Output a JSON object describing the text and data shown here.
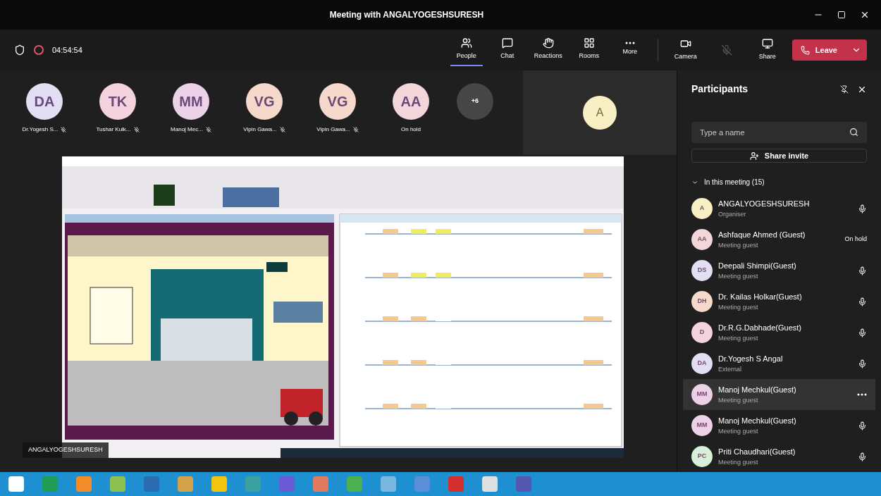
{
  "window": {
    "title": "Meeting with ANGALYOGESHSURESH"
  },
  "toolbar": {
    "timer": "04:54:54",
    "buttons": [
      {
        "label": "People",
        "selected": true
      },
      {
        "label": "Chat",
        "selected": false
      },
      {
        "label": "Reactions",
        "selected": false
      },
      {
        "label": "Rooms",
        "selected": false
      },
      {
        "label": "More",
        "selected": false
      }
    ],
    "devices": [
      {
        "label": "Camera",
        "disabled": false
      },
      {
        "disabled": true
      },
      {
        "label": "Share",
        "disabled": false
      }
    ],
    "leave": "Leave"
  },
  "gallery": [
    {
      "initials": "DA",
      "name": "Dr.Yogesh S...",
      "color": "#e2def4",
      "muted": true
    },
    {
      "initials": "TK",
      "name": "Tushar Kulk...",
      "color": "#f4d3df",
      "muted": true
    },
    {
      "initials": "MM",
      "name": "Manoj Mec...",
      "color": "#ecd1e8",
      "muted": true
    },
    {
      "initials": "VG",
      "name": "Vipin Gawa...",
      "color": "#f6d9ca",
      "muted": true
    },
    {
      "initials": "VG",
      "name": "Vipin Gawa...",
      "color": "#f6d9ca",
      "muted": true
    },
    {
      "initials": "AA",
      "name": "On hold",
      "color": "#f2d6da",
      "muted": false
    }
  ],
  "overflow": "+6",
  "self_tile": {
    "initials": "A"
  },
  "presenter": "ANGALYOGESHSURESH",
  "participants": {
    "title": "Participants",
    "search": {
      "placeholder": "Type a name"
    },
    "share_invite": "Share invite",
    "section": "In this meeting (15)",
    "expanded": true,
    "people": [
      {
        "initials": "A",
        "name": "ANGALYOGESHSURESH",
        "role": "Organiser",
        "color": "#f8efc4",
        "kind": "mic",
        "selected": false
      },
      {
        "initials": "AA",
        "name": "Ashfaque Ahmed (Guest)",
        "role": "Meeting guest",
        "color": "#f2d6da",
        "kind": "status",
        "status": "On hold",
        "selected": false
      },
      {
        "initials": "DS",
        "name": "Deepali Shimpi(Guest)",
        "role": "Meeting guest",
        "color": "#e2def4",
        "kind": "mic",
        "selected": false
      },
      {
        "initials": "DH",
        "name": "Dr. Kailas Holkar(Guest)",
        "role": "Meeting guest",
        "color": "#f6d9ca",
        "kind": "mic",
        "selected": false
      },
      {
        "initials": "D",
        "name": "Dr.R.G.Dabhade(Guest)",
        "role": "Meeting guest",
        "color": "#f4d3df",
        "kind": "mic",
        "selected": false
      },
      {
        "initials": "DA",
        "name": "Dr.Yogesh S Angal",
        "role": "External",
        "color": "#e2def4",
        "kind": "mic",
        "selected": false
      },
      {
        "initials": "MM",
        "name": "Manoj Mechkul(Guest)",
        "role": "Meeting guest",
        "color": "#ecd1e8",
        "kind": "more",
        "selected": true
      },
      {
        "initials": "MM",
        "name": "Manoj Mechkul(Guest)",
        "role": "Meeting guest",
        "color": "#ecd1e8",
        "kind": "mic",
        "selected": false
      },
      {
        "initials": "PC",
        "name": "Priti Chaudhari(Guest)",
        "role": "Meeting guest",
        "color": "#d8efd8",
        "kind": "mic",
        "selected": false
      }
    ]
  }
}
